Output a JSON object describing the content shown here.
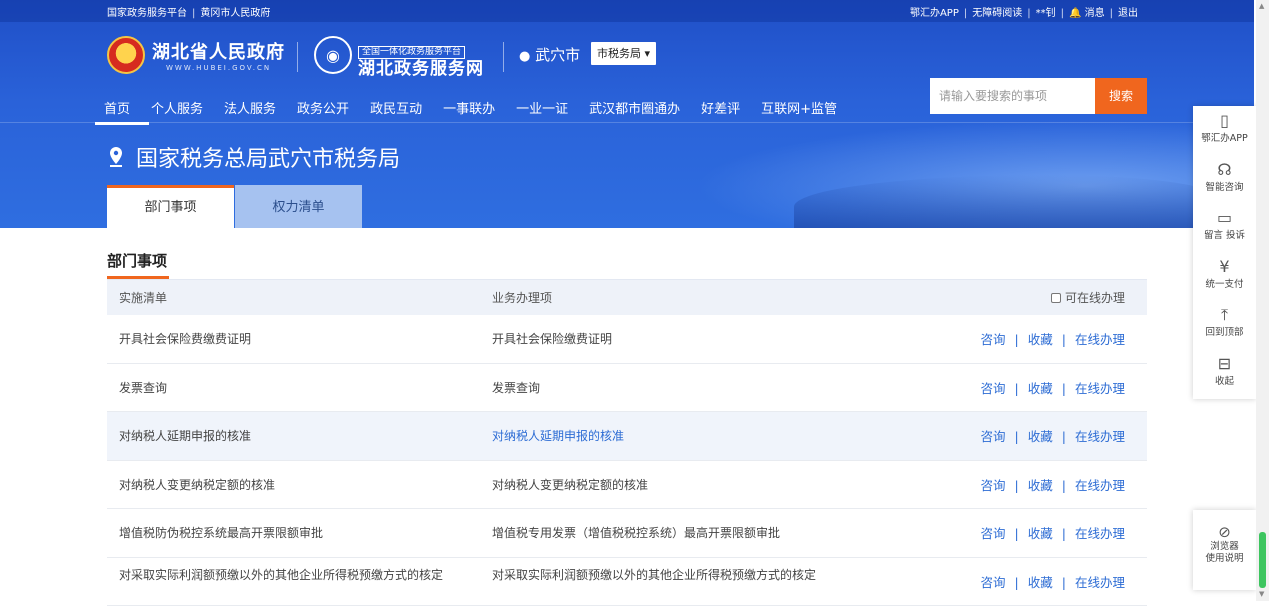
{
  "topbar": {
    "left": [
      "国家政务服务平台",
      "黄冈市人民政府"
    ],
    "right": [
      "鄂汇办APP",
      "无障碍阅读",
      "**钊",
      "消息",
      "退出"
    ]
  },
  "header": {
    "gov_name": "湖北省人民政府",
    "gov_url": "WWW.HUBEI.GOV.CN",
    "service_tag": "全国一体化政务服务平台",
    "service_name": "湖北政务服务网",
    "city": "武穴市",
    "city_dept": "市税务局",
    "search_placeholder": "请输入要搜索的事项",
    "search_button": "搜索"
  },
  "nav": [
    "首页",
    "个人服务",
    "法人服务",
    "政务公开",
    "政民互动",
    "一事联办",
    "一业一证",
    "武汉都市圈通办",
    "好差评",
    "互联网+监管"
  ],
  "dept_title": "国家税务总局武穴市税务局",
  "tabs": [
    "部门事项",
    "权力清单"
  ],
  "section_title": "部门事项",
  "table": {
    "headers": [
      "实施清单",
      "业务办理项",
      "可在线办理"
    ],
    "ops": [
      "咨询",
      "收藏",
      "在线办理"
    ],
    "rows": [
      {
        "name": "开具社会保险费缴费证明",
        "item": "开具社会保险缴费证明"
      },
      {
        "name": "发票查询",
        "item": "发票查询"
      },
      {
        "name": "对纳税人延期申报的核准",
        "item": "对纳税人延期申报的核准"
      },
      {
        "name": "对纳税人变更纳税定额的核准",
        "item": "对纳税人变更纳税定额的核准"
      },
      {
        "name": "增值税防伪税控系统最高开票限额审批",
        "item": "增值税专用发票（增值税税控系统）最高开票限额审批"
      },
      {
        "name": "对采取实际利润额预缴以外的其他企业所得税预缴方式的核定",
        "item": "对采取实际利润额预缴以外的其他企业所得税预缴方式的核定"
      }
    ]
  },
  "side": [
    "鄂汇办APP",
    "智能咨询",
    "留言 投诉",
    "统一支付",
    "回到顶部",
    "收起"
  ],
  "side2": [
    "浏览器",
    "使用说明"
  ],
  "colors": {
    "primary": "#2a62d9",
    "accent": "#f0661e",
    "link": "#2d6cd4"
  }
}
